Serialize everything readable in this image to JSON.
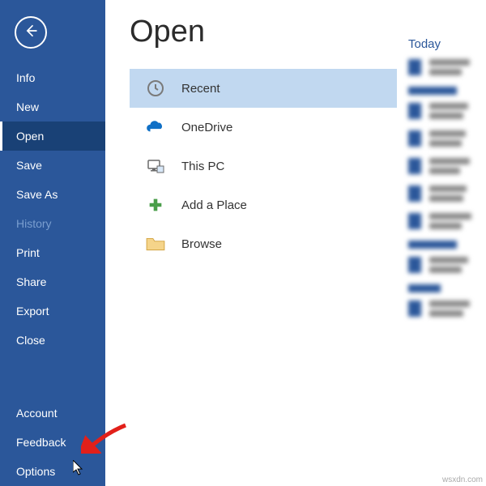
{
  "sidebar": {
    "items": [
      {
        "id": "info",
        "label": "Info"
      },
      {
        "id": "new",
        "label": "New"
      },
      {
        "id": "open",
        "label": "Open",
        "selected": true
      },
      {
        "id": "save",
        "label": "Save"
      },
      {
        "id": "saveas",
        "label": "Save As"
      },
      {
        "id": "history",
        "label": "History",
        "disabled": true
      },
      {
        "id": "print",
        "label": "Print"
      },
      {
        "id": "share",
        "label": "Share"
      },
      {
        "id": "export",
        "label": "Export"
      },
      {
        "id": "close",
        "label": "Close"
      }
    ],
    "bottom": [
      {
        "id": "account",
        "label": "Account"
      },
      {
        "id": "feedback",
        "label": "Feedback"
      },
      {
        "id": "options",
        "label": "Options"
      }
    ]
  },
  "main": {
    "title": "Open",
    "places": [
      {
        "id": "recent",
        "label": "Recent",
        "icon": "clock-icon",
        "selected": true
      },
      {
        "id": "onedrive",
        "label": "OneDrive",
        "icon": "cloud-icon"
      },
      {
        "id": "thispc",
        "label": "This PC",
        "icon": "pc-icon"
      },
      {
        "id": "addplace",
        "label": "Add a Place",
        "icon": "plus-icon"
      },
      {
        "id": "browse",
        "label": "Browse",
        "icon": "folder-icon"
      }
    ]
  },
  "recent": {
    "sections": [
      "Today"
    ]
  },
  "watermark": "wsxdn.com"
}
